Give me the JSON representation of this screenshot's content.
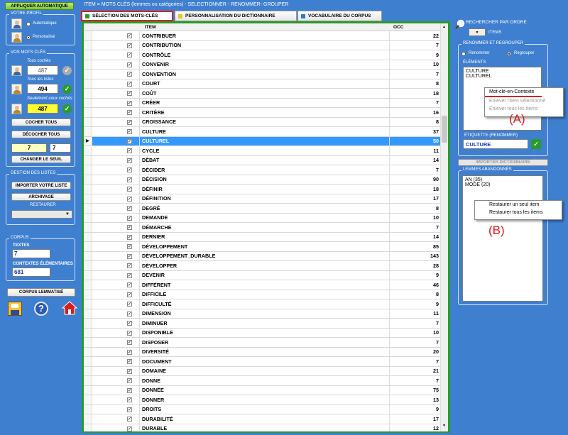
{
  "title_bar": "ITEM  = MOTS CLÉS (lemmes ou catégories) - SELECTIONNER - RENOMMER- GROUPER",
  "left": {
    "apply_auto": "APPLIQUER AUTOMATIQUE",
    "profile": {
      "title": "VOTRE PROFIL",
      "auto": "Automatique",
      "personal": "Personalisé"
    },
    "keywords": {
      "title": "VOS MOTS CLÉS",
      "all_checked": "Tous cochés",
      "all_checked_val": "487",
      "all_lists": "Tous les listes",
      "all_lists_val": "494",
      "only_checked": "Seulement ceux cochés",
      "only_checked_val": "487",
      "check_all": "COCHER TOUS",
      "uncheck_all": "DÉCOCHER TOUS",
      "v1": "7",
      "v2": "7",
      "change_threshold": "CHANGER LE SEUIL"
    },
    "lists": {
      "title": "GESTION DES LISTES",
      "import": "IMPORTER VOTRE LISTE",
      "archive": "ARCHIVAGE",
      "restore": "RESTAURER"
    },
    "corpus": {
      "title": "CORPUS",
      "texts": "TEXTES",
      "texts_val": "7",
      "contexts": "CONTEXTES ÉLÉMENTAIRES",
      "contexts_val": "681",
      "lemmatized": "CORPUS LEMMATISÉ"
    },
    "icons": [
      "save-icon",
      "help-icon",
      "home-icon"
    ]
  },
  "tabs": [
    {
      "label": "SÉLECTION DES MOTS-CLÉS",
      "color": "#2a9a2a"
    },
    {
      "label": "PERSONNALISATION DU DICTIONNAIRE",
      "color": "#f0c020"
    },
    {
      "label": "VOCABULAIRE DU CORPUS",
      "color": "#2a7ad0"
    }
  ],
  "table": {
    "headers": [
      "ITEM",
      "OCC"
    ],
    "rows": [
      [
        "CONTRIBUER",
        "22"
      ],
      [
        "CONTRIBUTION",
        "7"
      ],
      [
        "CONTRÔLE",
        "9"
      ],
      [
        "CONVENIR",
        "10"
      ],
      [
        "CONVENTION",
        "7"
      ],
      [
        "COURT",
        "8"
      ],
      [
        "COÛT",
        "18"
      ],
      [
        "CRÉER",
        "7"
      ],
      [
        "CRITÈRE",
        "16"
      ],
      [
        "CROISSANCE",
        "8"
      ],
      [
        "CULTURE",
        "37"
      ],
      [
        "CULTUREL",
        "50"
      ],
      [
        "CYCLE",
        "11"
      ],
      [
        "DÉBAT",
        "14"
      ],
      [
        "DÉCIDER",
        "7"
      ],
      [
        "DÉCISION",
        "90"
      ],
      [
        "DÉFINIR",
        "18"
      ],
      [
        "DÉFINITION",
        "17"
      ],
      [
        "DEGRÉ",
        "8"
      ],
      [
        "DEMANDE",
        "10"
      ],
      [
        "DÉMARCHE",
        "7"
      ],
      [
        "DERNIER",
        "14"
      ],
      [
        "DÉVELOPPEMENT",
        "85"
      ],
      [
        "DÉVELOPPEMENT_DURABLE",
        "143"
      ],
      [
        "DÉVELOPPER",
        "28"
      ],
      [
        "DEVENIR",
        "9"
      ],
      [
        "DIFFÉRENT",
        "46"
      ],
      [
        "DIFFICILE",
        "8"
      ],
      [
        "DIFFICULTÉ",
        "9"
      ],
      [
        "DIMENSION",
        "11"
      ],
      [
        "DIMINUER",
        "7"
      ],
      [
        "DISPONIBLE",
        "10"
      ],
      [
        "DISPOSER",
        "7"
      ],
      [
        "DIVERSITÉ",
        "20"
      ],
      [
        "DOCUMENT",
        "7"
      ],
      [
        "DOMAINE",
        "21"
      ],
      [
        "DONNE",
        "7"
      ],
      [
        "DONNÉE",
        "75"
      ],
      [
        "DONNER",
        "13"
      ],
      [
        "DROITS",
        "9"
      ],
      [
        "DURABILITÉ",
        "17"
      ],
      [
        "DURABLE",
        "12"
      ]
    ],
    "selected_index": 11
  },
  "right": {
    "search_order": "RECHERCHER PAR ORDRE",
    "items": "ITEMS",
    "rename_group": {
      "title": "RENOMMER ET REGROUPER",
      "rename": "Renommer",
      "regroup": "Regrouper",
      "elements": "ÉLÉMENTS",
      "list": [
        "CULTURE",
        "CULTUREL"
      ],
      "label_title": "ÉTIQUETTE (RENOMMER)",
      "label_value": "CULTURE"
    },
    "ctx_a": [
      "Mot-clé-en-Contexte",
      "Enlever l'item sélectionné",
      "Enlever tous les items"
    ],
    "mark_a": "(A)",
    "import_dict": "IMPORTER DICTIONNAIRE",
    "abandoned": {
      "title": "LEMMES ABANDONNÉS",
      "list": [
        "AN (35)",
        "MODE (20)"
      ]
    },
    "ctx_b": [
      "Restaurer un seul item",
      "Restaurer tous les items"
    ],
    "mark_b": "(B)"
  }
}
